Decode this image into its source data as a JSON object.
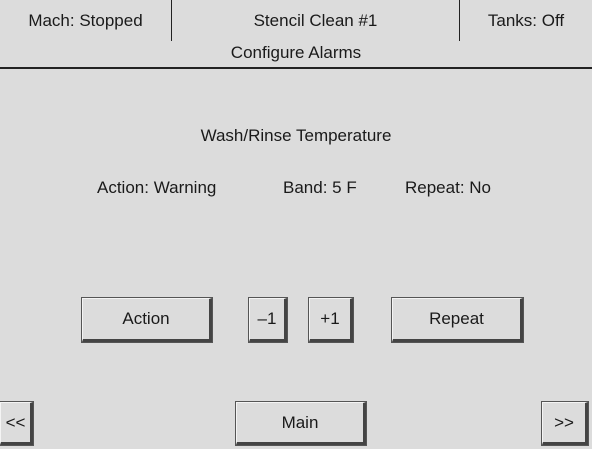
{
  "header": {
    "machine_status": "Mach: Stopped",
    "screen_name": "Stencil Clean #1",
    "tanks_status": "Tanks: Off",
    "subtitle": "Configure Alarms"
  },
  "alarm": {
    "title": "Wash/Rinse Temperature",
    "action": "Action: Warning",
    "band": "Band: 5 F",
    "repeat": "Repeat: No"
  },
  "buttons": {
    "action": "Action",
    "minus_one": "–1",
    "plus_one": "+1",
    "repeat": "Repeat",
    "prev": "<<",
    "main": "Main",
    "next": ">>"
  }
}
